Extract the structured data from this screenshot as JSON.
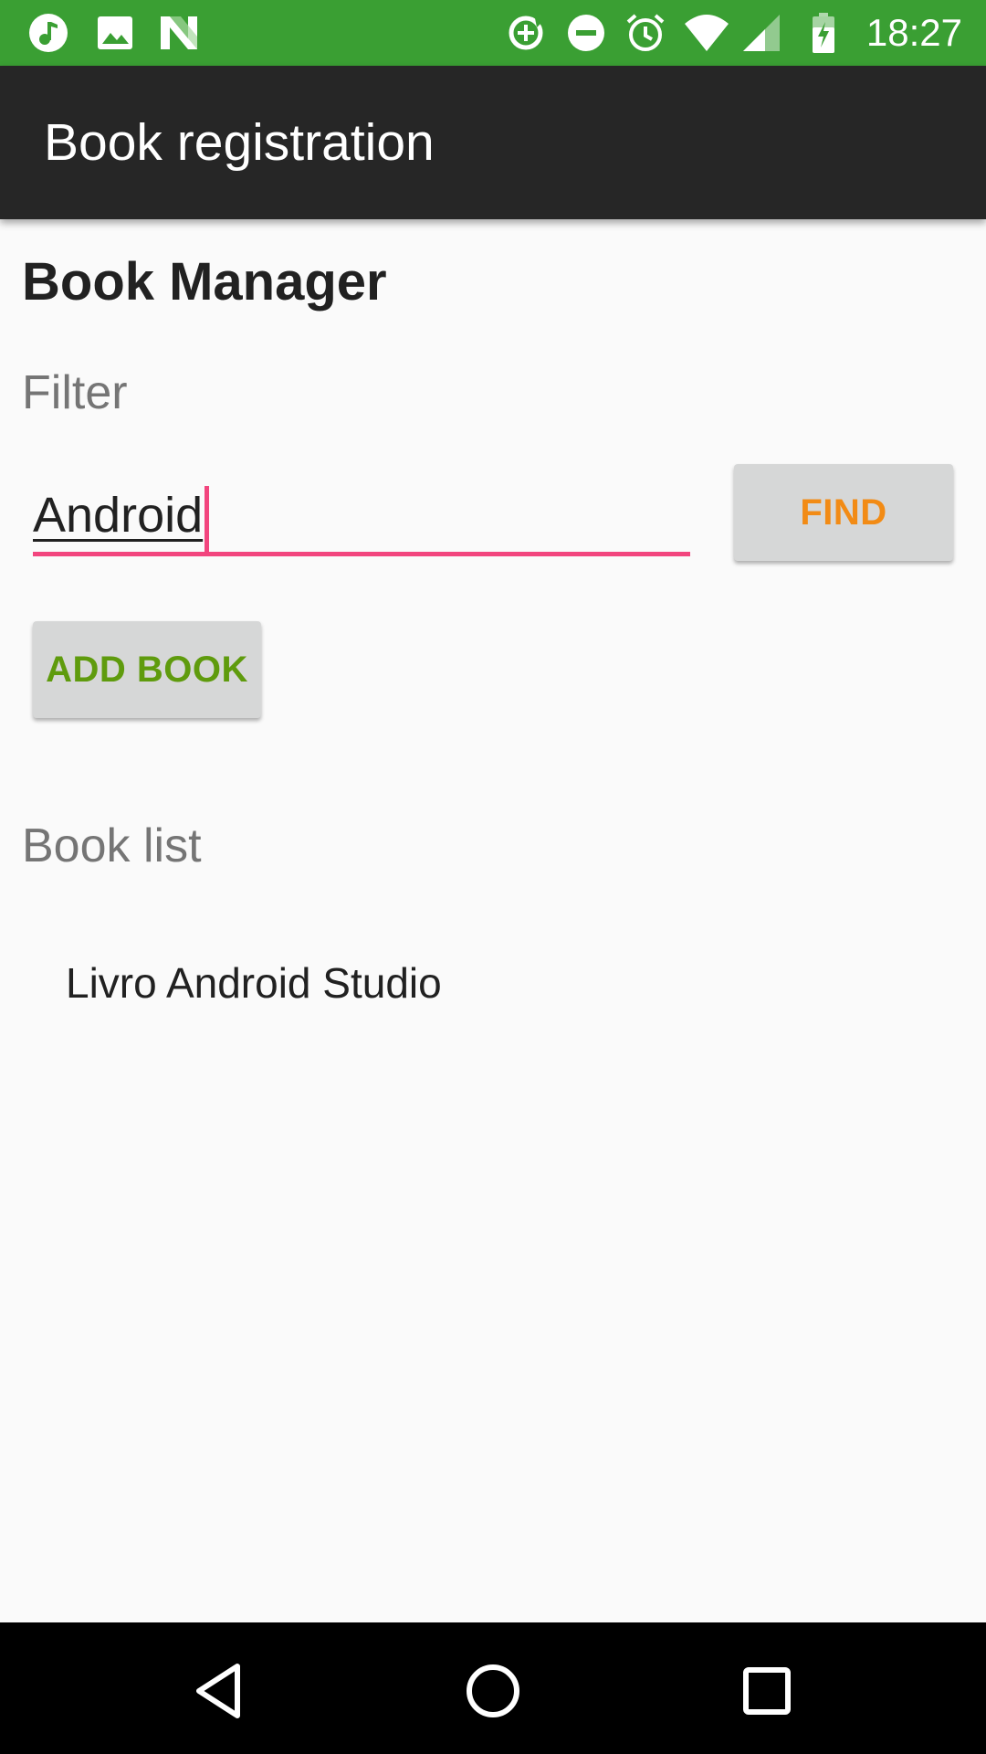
{
  "status_bar": {
    "time": "18:27",
    "background": "#3a9f33",
    "left_icons": [
      "music-note-icon",
      "image-icon",
      "n-notification-icon"
    ],
    "right_icons": [
      "data-saver-icon",
      "do-not-disturb-icon",
      "alarm-icon",
      "wifi-icon",
      "signal-icon",
      "battery-charging-icon"
    ]
  },
  "app_bar": {
    "title": "Book registration",
    "background": "#262626"
  },
  "main": {
    "heading": "Book Manager",
    "filter_label": "Filter",
    "filter_value": "Android",
    "find_button": "FIND",
    "add_button": "ADD BOOK",
    "book_list_label": "Book list",
    "books": [
      "Livro Android Studio"
    ]
  },
  "colors": {
    "accent": "#f2457e",
    "find_text": "#f28b15",
    "add_text": "#5f9b0d"
  },
  "nav_bar": {
    "buttons": [
      "back-icon",
      "home-icon",
      "recents-icon"
    ]
  }
}
